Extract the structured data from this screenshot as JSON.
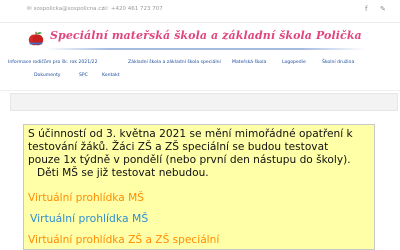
{
  "topbar": {
    "email": "sospolicka@sospolicna.cz",
    "phone": "+420 461 723 707",
    "social": [
      "f",
      "✎"
    ]
  },
  "header": {
    "site_title": "Speciální mateřská škola a základní škola Polička"
  },
  "nav": {
    "items": [
      "Informace rodičům pro šk. rok 2021/22",
      "Základní škola a základní škola speciální",
      "Mateřská škola",
      "Logopedie",
      "Školní družina",
      "Dokumenty",
      "SPC",
      "Kontakt"
    ]
  },
  "notice": {
    "lines": [
      "S účinností od 3. května 2021 se mění mimořádné opatření k",
      "testování žáků. Žáci ZŠ a ZŠ speciální se budou testovat",
      "pouze 1x týdně v pondělí (nebo první den nástupu do školy).",
      "Děti MŠ se již testovat nebudou."
    ]
  },
  "links": {
    "ms": "Virtuální prohlídka MŠ",
    "ms_alt": "Virtuální prohlídka MŠ",
    "zs": "Virtuální prohlídka ZŠ a ZŠ speciální"
  },
  "colors": {
    "title": "#e0457e",
    "nav": "#1a4b9a",
    "notice_bg": "#ffffa8",
    "link_orange": "#ff8c00",
    "link_blue": "#2f8fd0"
  }
}
